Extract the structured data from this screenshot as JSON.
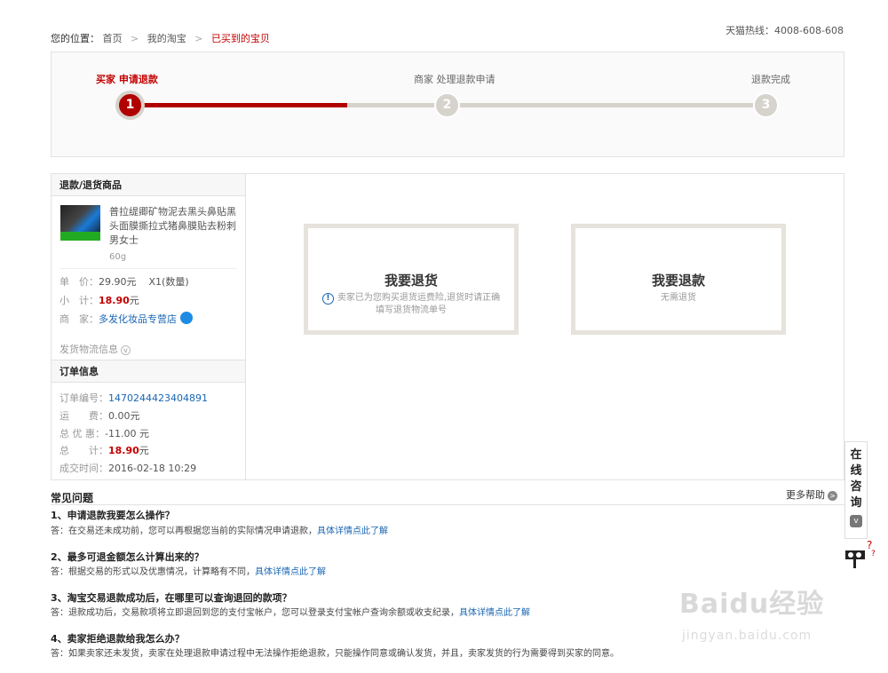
{
  "breadcrumb": {
    "label": "您的位置：",
    "items": [
      "首页",
      "我的淘宝"
    ],
    "current": "已买到的宝贝"
  },
  "hotline": "天猫热线：4008-608-608",
  "steps": [
    {
      "label": "买家 申请退款",
      "number": "1",
      "active": true
    },
    {
      "label": "商家 处理退款申请",
      "number": "2",
      "active": false
    },
    {
      "label": "退款完成",
      "number": "3",
      "active": false
    }
  ],
  "progress": 0.34,
  "product_section": {
    "title": "退款/退货商品",
    "name": "普拉缇卿矿物泥去黑头鼻贴黑头面膜撕拉式猪鼻膜贴去粉刺男女士",
    "sku": "60g",
    "price_label": "单　价：",
    "price": "29.90元",
    "quantity": "X1(数量)",
    "subtotal_label": "小　计：",
    "subtotal": "18.90",
    "subtotal_unit": "元",
    "seller_label": "商　家：",
    "seller": "多发化妆品专营店",
    "logistics": "发货物流信息"
  },
  "order_section": {
    "title": "订单信息",
    "order_no_label": "订单编号：",
    "order_no": "1470244423404891",
    "shipping_label": "运　　费：",
    "shipping": "0.00元",
    "discount_label": "总 优 惠：",
    "discount": "-11.00 元",
    "total_label": "总　　计：",
    "total": "18.90",
    "total_unit": "元",
    "time_label": "成交时间：",
    "time": "2016-02-18 10:29"
  },
  "options": {
    "return": {
      "title": "我要退货",
      "desc_line1": "卖家已为您购买退货运费险,退货时请正确",
      "desc_line2": "填写退货物流单号"
    },
    "refund": {
      "title": "我要退款",
      "desc": "无需退货"
    }
  },
  "faq": {
    "title": "常见问题",
    "more": "更多帮助",
    "items": [
      {
        "q": "1、申请退款我要怎么操作？",
        "a": "答：在交易还未成功前，您可以再根据您当前的实际情况申请退款，",
        "link": "具体详情点此了解"
      },
      {
        "q": "2、最多可退金额怎么计算出来的？",
        "a": "答：根据交易的形式以及优惠情况，计算略有不同，",
        "link": "具体详情点此了解"
      },
      {
        "q": "3、淘宝交易退款成功后，在哪里可以查询退回的款项？",
        "a": "答：退款成功后，交易款项将立即退回到您的支付宝帐户，您可以登录支付宝帐户查询余额或收支纪录，",
        "link": "具体详情点此了解"
      },
      {
        "q": "4、卖家拒绝退款给我怎么办？",
        "a": "答：如果卖家还未发货，卖家在处理退款申请过程中无法操作拒绝退款，只能操作同意或确认发货，并且，卖家发货的行为需要得到买家的同意。",
        "link": ""
      }
    ]
  },
  "consult": "在线咨询",
  "watermark": {
    "main": "Baidu经验",
    "sub": "jingyan.baidu.com"
  },
  "colors": {
    "accent": "#b00000",
    "link": "#1a66b3",
    "track": "#d6d2cc"
  },
  "icons": [
    "info-icon",
    "wangwang-icon",
    "chevron-down-icon",
    "arrow-right-icon",
    "mascot-icon"
  ]
}
